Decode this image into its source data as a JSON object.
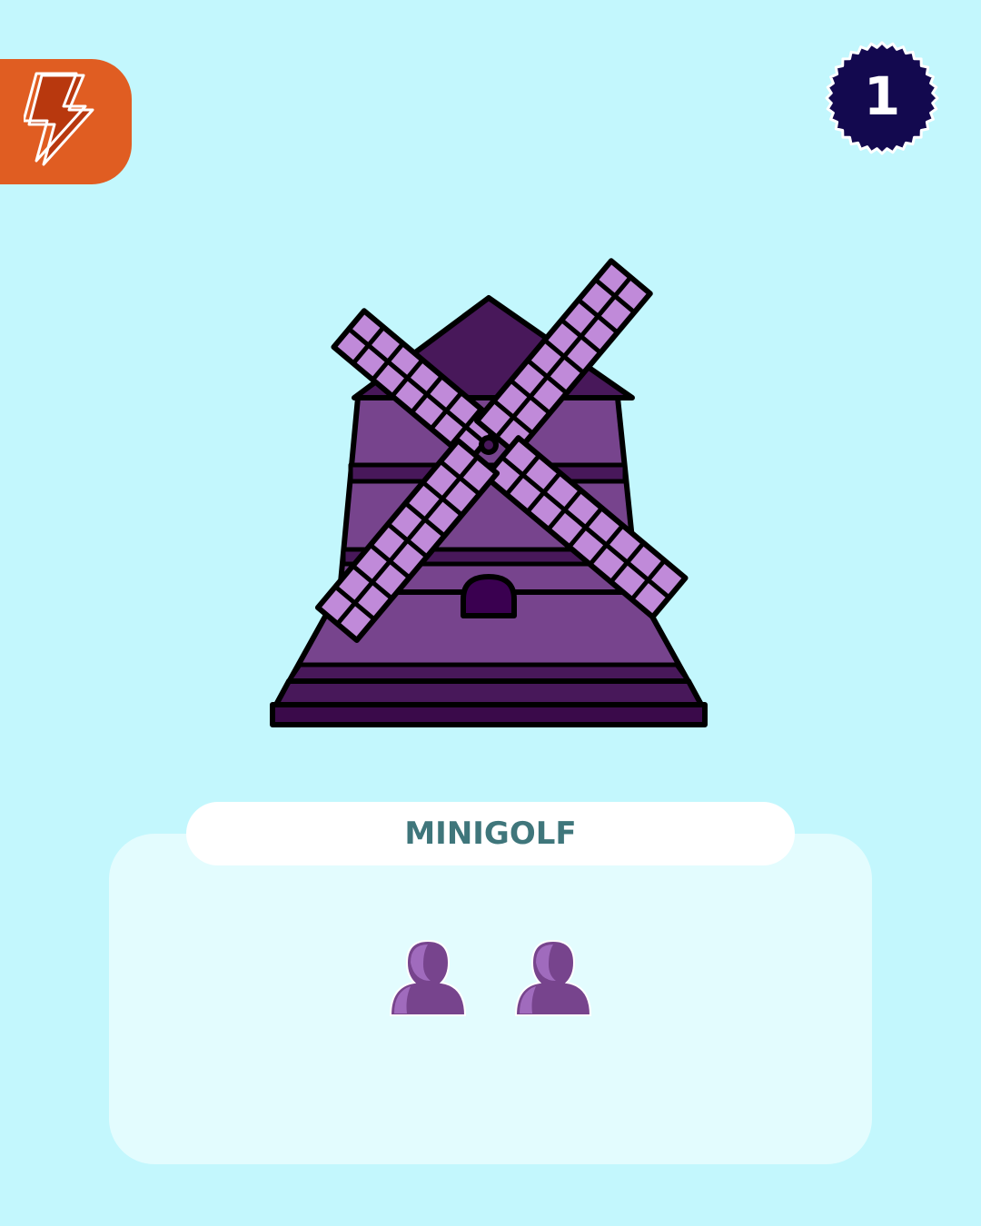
{
  "card": {
    "title": "MINIGOLF",
    "round_number": "1",
    "players": [
      {
        "icon": "player-icon"
      },
      {
        "icon": "player-icon"
      }
    ]
  },
  "icons": {
    "corner": "lightning-bolt-icon",
    "illustration": "windmill-icon"
  },
  "colors": {
    "background": "#c3f7fd",
    "panel": "#e3fcfe",
    "corner_badge": "#e05d22",
    "round_badge": "#13094f",
    "title_text": "#3f767b",
    "windmill_dark": "#48185a",
    "windmill_mid": "#77448d",
    "windmill_blade": "#c08ad9",
    "player": "#77448d"
  }
}
